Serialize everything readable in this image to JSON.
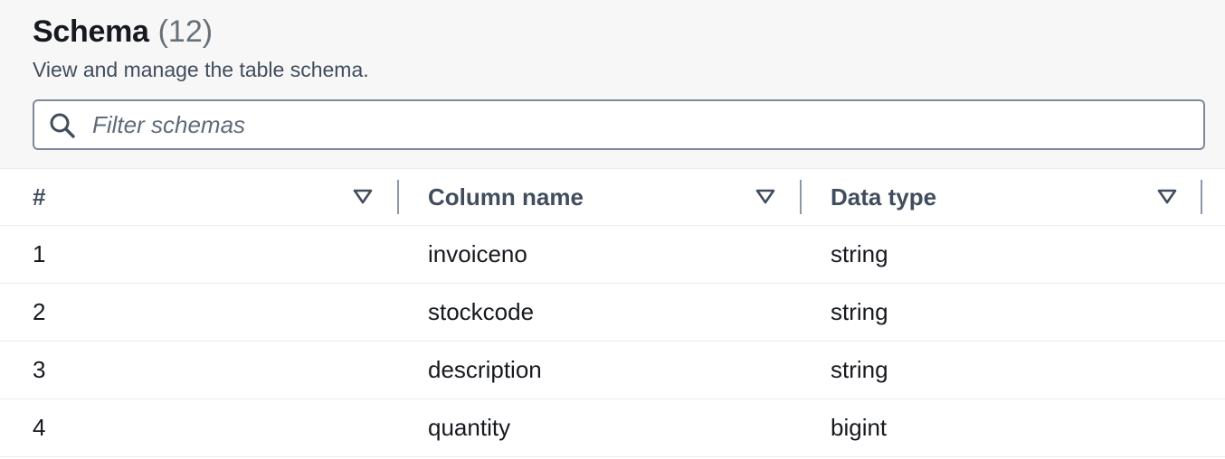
{
  "header": {
    "title": "Schema",
    "count": "(12)",
    "description": "View and manage the table schema."
  },
  "filter": {
    "placeholder": "Filter schemas",
    "value": ""
  },
  "table": {
    "columns": [
      {
        "label": "#",
        "icon": "sort-caret-down-icon"
      },
      {
        "label": "Column name",
        "icon": "sort-caret-down-icon"
      },
      {
        "label": "Data type",
        "icon": "sort-caret-down-icon"
      }
    ],
    "rows": [
      {
        "index": "1",
        "name": "invoiceno",
        "type": "string"
      },
      {
        "index": "2",
        "name": "stockcode",
        "type": "string"
      },
      {
        "index": "3",
        "name": "description",
        "type": "string"
      },
      {
        "index": "4",
        "name": "quantity",
        "type": "bigint"
      }
    ]
  },
  "colors": {
    "header_background": "#f7f7f8",
    "text_primary": "#16191f",
    "text_secondary": "#414d5c",
    "count_gray": "#687078",
    "border": "#7d8998",
    "row_divider": "#e9ebed"
  }
}
